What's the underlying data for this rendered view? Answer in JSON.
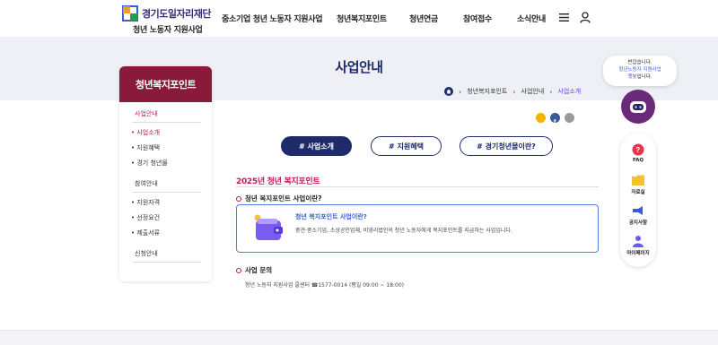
{
  "header": {
    "logo_top": "경기도일자리재단",
    "logo_sub": "청년 노동자 지원사업",
    "nav": [
      "중소기업 청년 노동자 지원사업",
      "청년복지포인트",
      "청년연금",
      "참여접수",
      "소식안내"
    ]
  },
  "hero": {
    "title": "사업안내",
    "breadcrumb": [
      "청년복지포인트",
      "사업안내",
      "사업소개"
    ]
  },
  "lnb": {
    "title": "청년복지포인트",
    "groups": [
      {
        "label": "사업안내",
        "items": [
          "사업소개",
          "지원혜택",
          "경기 청년몰"
        ]
      },
      {
        "label": "참여안내",
        "items": [
          "지원자격",
          "선정요건",
          "제출서류"
        ]
      },
      {
        "label": "신청안내",
        "items": []
      }
    ]
  },
  "tabs": [
    "# 사업소개",
    "# 지원혜택",
    "# 경기청년몰이란?"
  ],
  "content": {
    "section_title": "2025년 청년 복지포인트",
    "question": "청년 복지포인트 사업이란?",
    "box_title": "청년 복지포인트 사업이란?",
    "box_desc": "중견·중소기업, 소상공인업체, 비영리법인의 청년 노동자에게 복지포인트를 지급하는 사업입니다.",
    "contact_title": "사업 문의",
    "contact_text": "청년 노동자 지원사업 콜센터 ☎1577-0014 (평일 09:00 ~ 18:00)"
  },
  "quick": {
    "bubble_line1": "반갑습니다.",
    "bubble_line2": "청년노동자 지원사업",
    "bubble_line3_hl": "챗봇",
    "bubble_line3": "입니다.",
    "items": [
      "FAQ",
      "자료실",
      "공지사항",
      "마이페이지"
    ]
  },
  "colors": {
    "navy": "#1f2a6b",
    "burgundy": "#8a1a3a",
    "pink": "#c2185b",
    "blue": "#3b5bdb"
  }
}
